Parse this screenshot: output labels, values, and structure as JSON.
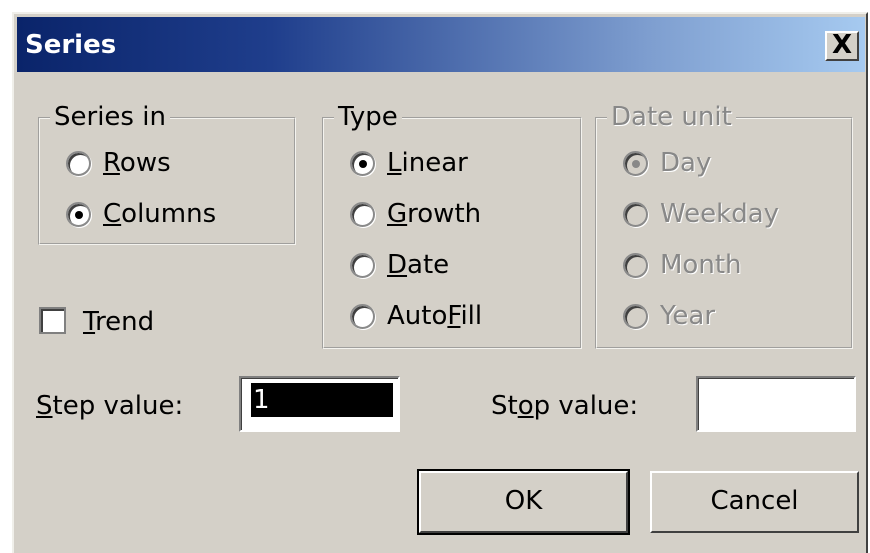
{
  "dialog": {
    "title": "Series",
    "close_glyph": "X"
  },
  "series_in": {
    "legend": "Series in",
    "options": [
      {
        "pre": "",
        "key": "R",
        "post": "ows",
        "checked": false
      },
      {
        "pre": "",
        "key": "C",
        "post": "olumns",
        "checked": true
      }
    ]
  },
  "type": {
    "legend": "Type",
    "options": [
      {
        "pre": "",
        "key": "L",
        "post": "inear",
        "checked": true
      },
      {
        "pre": "",
        "key": "G",
        "post": "rowth",
        "checked": false
      },
      {
        "pre": "",
        "key": "D",
        "post": "ate",
        "checked": false
      },
      {
        "pre": "Auto",
        "key": "F",
        "post": "ill",
        "checked": false
      }
    ]
  },
  "date_unit": {
    "legend": "Date unit",
    "disabled": true,
    "options": [
      {
        "label": "Day",
        "checked": true
      },
      {
        "label": "Weekday",
        "checked": false
      },
      {
        "label": "Month",
        "checked": false
      },
      {
        "label": "Year",
        "checked": false
      }
    ]
  },
  "trend": {
    "key": "T",
    "post": "rend",
    "checked": false
  },
  "step_value": {
    "key": "S",
    "post": "tep value:",
    "value": "1"
  },
  "stop_value": {
    "pre": "St",
    "key": "o",
    "post": "p value:",
    "value": ""
  },
  "buttons": {
    "ok": "OK",
    "cancel": "Cancel"
  },
  "colors": {
    "face": "#d4d0c8",
    "title_start": "#0a246a",
    "title_end": "#a6caf0",
    "disabled_text": "#888888"
  }
}
